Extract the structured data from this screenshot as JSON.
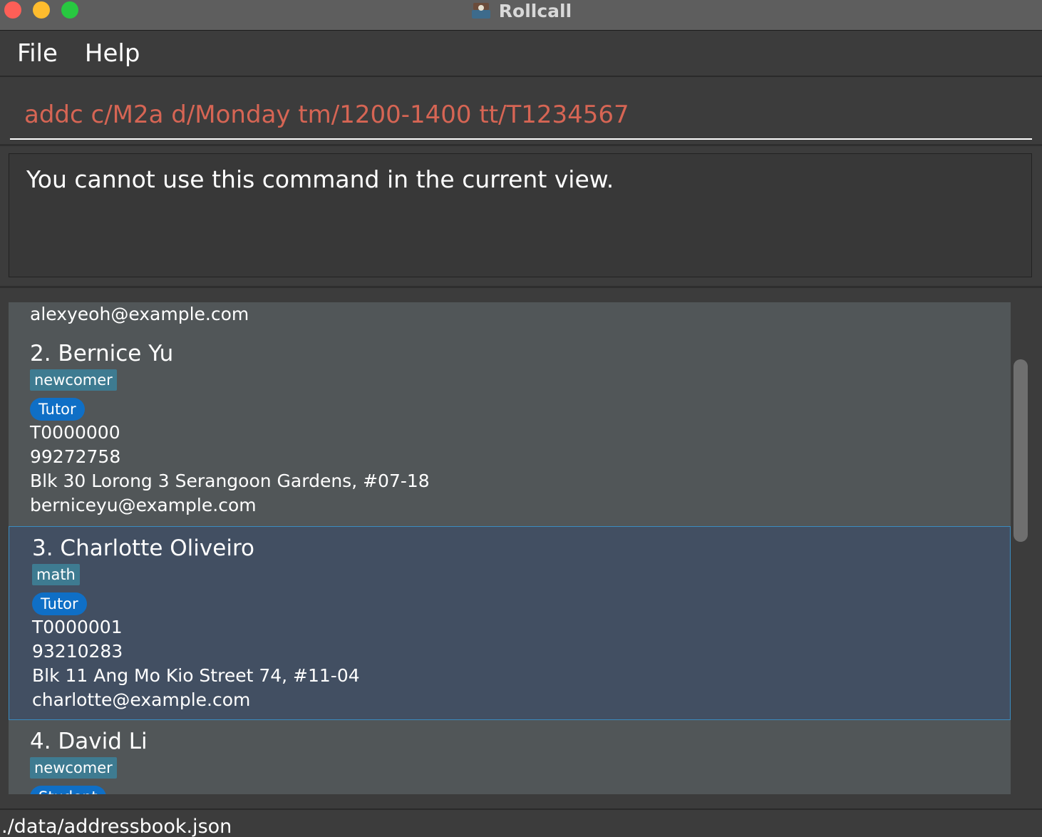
{
  "window": {
    "title": "Rollcall"
  },
  "menu": {
    "file": "File",
    "help": "Help"
  },
  "command": {
    "value": "addc c/M2a d/Monday tm/1200-1400 tt/T1234567"
  },
  "result": {
    "message": "You cannot use this command in the current view."
  },
  "persons": [
    {
      "email": "alexyeoh@example.com"
    },
    {
      "name": "2. Bernice Yu",
      "tag": "newcomer",
      "role": "Tutor",
      "id": "T0000000",
      "phone": "99272758",
      "address": "Blk 30 Lorong 3 Serangoon Gardens, #07-18",
      "email": "berniceyu@example.com"
    },
    {
      "name": "3. Charlotte Oliveiro",
      "tag": "math",
      "role": "Tutor",
      "id": "T0000001",
      "phone": "93210283",
      "address": "Blk 11 Ang Mo Kio Street 74, #11-04",
      "email": "charlotte@example.com"
    },
    {
      "name": "4. David Li",
      "tag": "newcomer",
      "role": "Student"
    }
  ],
  "status": {
    "path": "./data/addressbook.json"
  },
  "colors": {
    "accent_command": "#d66554",
    "tag": "#3e7b91",
    "role": "#0f6fc6",
    "selected_card": "#424f62"
  }
}
